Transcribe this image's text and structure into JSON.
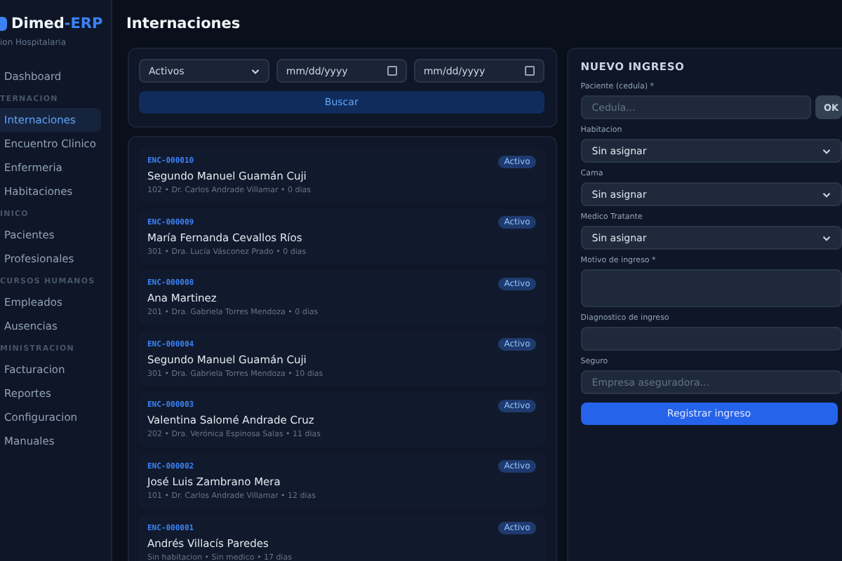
{
  "sidebar": {
    "brand": {
      "name": "Dimed",
      "suffix": "-ERP",
      "subtitle": "ion Hospitalaria"
    },
    "groups": [
      {
        "items": [
          {
            "label": "Dashboard",
            "selected": false
          }
        ]
      },
      {
        "heading": "TERNACION",
        "items": [
          {
            "label": "Internaciones",
            "selected": true
          },
          {
            "label": "Encuentro Clinico",
            "selected": false
          },
          {
            "label": "Enfermeria",
            "selected": false
          },
          {
            "label": "Habitaciones",
            "selected": false
          }
        ]
      },
      {
        "heading": "INICO",
        "items": [
          {
            "label": "Pacientes",
            "selected": false
          },
          {
            "label": "Profesionales",
            "selected": false
          }
        ]
      },
      {
        "heading": "CURSOS HUMANOS",
        "items": [
          {
            "label": "Empleados",
            "selected": false
          },
          {
            "label": "Ausencias",
            "selected": false
          }
        ]
      },
      {
        "heading": "MINISTRACION",
        "items": [
          {
            "label": "Facturacion",
            "selected": false
          },
          {
            "label": "Reportes",
            "selected": false
          },
          {
            "label": "Configuracion",
            "selected": false
          },
          {
            "label": "Manuales",
            "selected": false
          }
        ]
      }
    ]
  },
  "page_title": "Internaciones",
  "filters": {
    "status": "Activos",
    "date_from": {
      "placeholder": "mm/dd/yyyy"
    },
    "date_to": {
      "placeholder": "mm/dd/yyyy"
    },
    "button": "Buscar"
  },
  "encounters": [
    {
      "code": "ENC-000010",
      "status": "Activo",
      "patient": "Segundo Manuel Guamán Cuji",
      "details": "102 • Dr. Carlos Andrade Villamar • 0 dias"
    },
    {
      "code": "ENC-000009",
      "status": "Activo",
      "patient": "María Fernanda Cevallos Ríos",
      "details": "301 • Dra. Lucía Vásconez Prado • 0 dias"
    },
    {
      "code": "ENC-000008",
      "status": "Activo",
      "patient": "Ana Martinez",
      "details": "201 • Dra. Gabriela Torres Mendoza • 0 dias"
    },
    {
      "code": "ENC-000004",
      "status": "Activo",
      "patient": "Segundo Manuel Guamán Cuji",
      "details": "301 • Dra. Gabriela Torres Mendoza • 10 dias"
    },
    {
      "code": "ENC-000003",
      "status": "Activo",
      "patient": "Valentina Salomé Andrade Cruz",
      "details": "202 • Dra. Verónica Espinosa Salas • 11 dias"
    },
    {
      "code": "ENC-000002",
      "status": "Activo",
      "patient": "José Luis Zambrano Mera",
      "details": "101 • Dr. Carlos Andrade Villamar • 12 dias"
    },
    {
      "code": "ENC-000001",
      "status": "Activo",
      "patient": "Andrés Villacís Paredes",
      "details": "Sin habitacion • Sin medico • 17 dias"
    }
  ],
  "admission_form": {
    "title": "NUEVO INGRESO",
    "fields": [
      {
        "kind": "lookup",
        "label": "Paciente (cedula) *",
        "placeholder": "Cedula...",
        "button": "OK"
      },
      {
        "kind": "select",
        "label": "Habitacion",
        "value": "Sin asignar"
      },
      {
        "kind": "select",
        "label": "Cama",
        "value": "Sin asignar"
      },
      {
        "kind": "select",
        "label": "Medico Tratante",
        "value": "Sin asignar"
      },
      {
        "kind": "textarea",
        "label": "Motivo de ingreso *"
      },
      {
        "kind": "input",
        "label": "Diagnostico de ingreso"
      },
      {
        "kind": "input",
        "label": "Seguro",
        "placeholder": "Empresa aseguradora..."
      }
    ],
    "submit": "Registrar ingreso"
  }
}
